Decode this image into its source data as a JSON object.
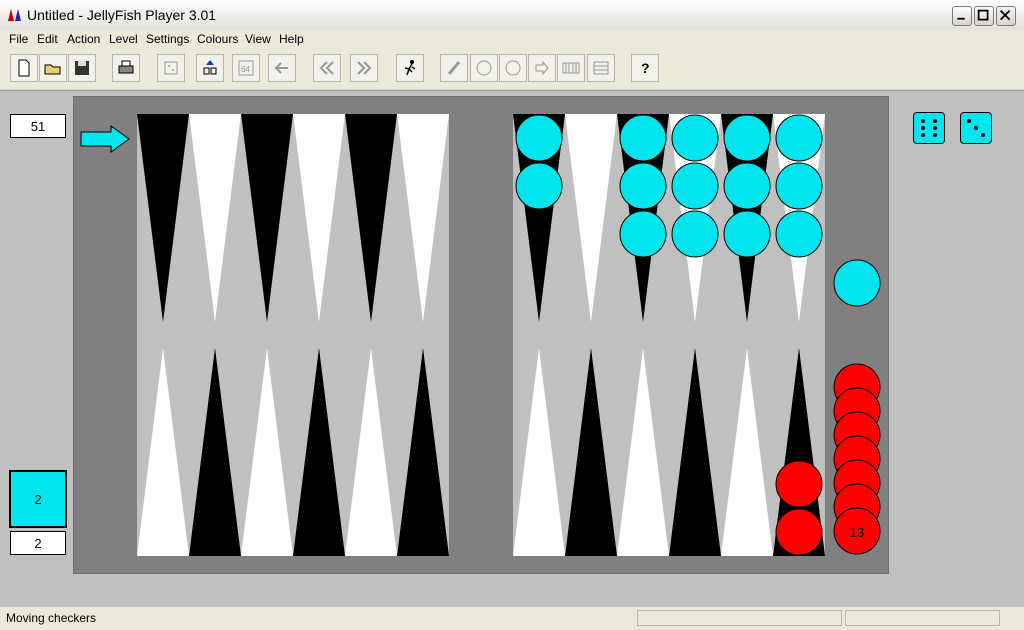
{
  "window": {
    "title": "Untitled - JellyFish Player 3.01"
  },
  "menu": [
    "File",
    "Edit",
    "Action",
    "Level",
    "Settings",
    "Colours",
    "View",
    "Help"
  ],
  "match": {
    "match_length_label": "51",
    "cube_value": "2",
    "score_label": "2",
    "borne_off_count_label": "13"
  },
  "dice": [
    6,
    3
  ],
  "status": {
    "message": "Moving checkers"
  },
  "colors": {
    "player_one_checker": "#00ffff",
    "player_two_checker": "#ff0000",
    "dark_point": "#000000",
    "light_point": "#ffffff",
    "board_felt": "#c0c0c0",
    "board_frame": "#808080"
  },
  "board_position": {
    "top_row_checkers": [
      {
        "point_index": 0,
        "color": "cyan",
        "count": 0
      },
      {
        "point_index": 6,
        "color": "cyan",
        "count": 2
      },
      {
        "point_index": 8,
        "color": "cyan",
        "count": 3
      },
      {
        "point_index": 9,
        "color": "cyan",
        "count": 3
      },
      {
        "point_index": 10,
        "color": "cyan",
        "count": 3
      },
      {
        "point_index": 11,
        "color": "cyan",
        "count": 3
      }
    ],
    "bottom_row_checkers": [
      {
        "point_index": 11,
        "color": "red",
        "count": 2
      }
    ],
    "cyan_on_bar_side": 1,
    "red_borne_off": 13
  }
}
